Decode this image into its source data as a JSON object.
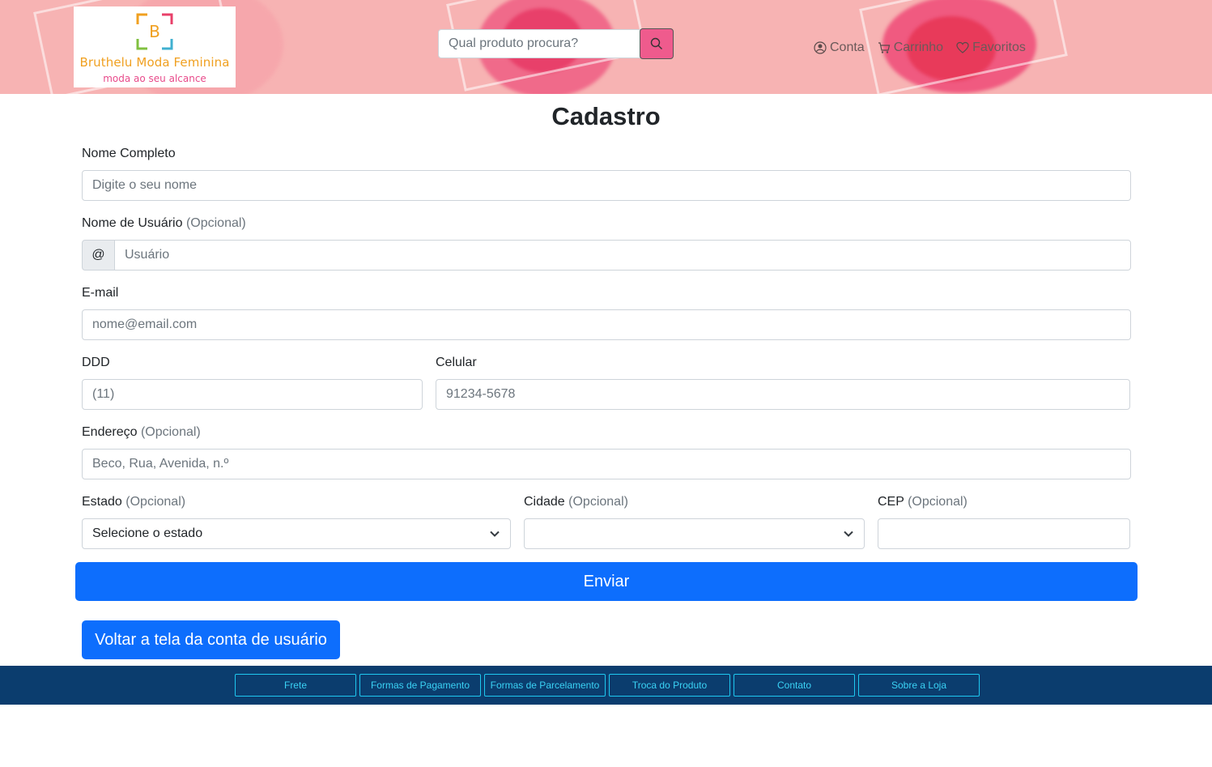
{
  "header": {
    "logo": {
      "letter": "B",
      "title": "Bruthelu Moda Feminina",
      "subtitle": "moda ao seu alcance"
    },
    "search": {
      "placeholder": "Qual produto procura?",
      "icon": "search-icon"
    },
    "nav": [
      {
        "label": "Conta",
        "icon": "user-circle-icon"
      },
      {
        "label": "Carrinho",
        "icon": "cart-icon"
      },
      {
        "label": "Favoritos",
        "icon": "heart-icon"
      }
    ]
  },
  "page": {
    "title": "Cadastro"
  },
  "form": {
    "full_name": {
      "label": "Nome Completo",
      "placeholder": "Digite o seu nome"
    },
    "username": {
      "label": "Nome de Usuário",
      "optional": "(Opcional)",
      "addon": "@",
      "placeholder": "Usuário"
    },
    "email": {
      "label": "E-mail",
      "placeholder": "nome@email.com"
    },
    "ddd": {
      "label": "DDD",
      "placeholder": "(11)"
    },
    "phone": {
      "label": "Celular",
      "placeholder": "91234-5678"
    },
    "address": {
      "label": "Endereço",
      "optional": "(Opcional)",
      "placeholder": "Beco, Rua, Avenida, n.º"
    },
    "state": {
      "label": "Estado",
      "optional": "(Opcional)",
      "selected": "Selecione o estado"
    },
    "city": {
      "label": "Cidade",
      "optional": "(Opcional)",
      "selected": ""
    },
    "cep": {
      "label": "CEP",
      "optional": "(Opcional)",
      "value": ""
    },
    "submit_label": "Enviar",
    "back_label": "Voltar a tela da conta de usuário"
  },
  "footer": {
    "links": [
      "Frete",
      "Formas de Pagamento",
      "Formas de Parcelamento",
      "Troca do Produto",
      "Contato",
      "Sobre a Loja"
    ]
  },
  "colors": {
    "header_bg": "#f7b3b3",
    "primary": "#0d6efd",
    "footer_bg": "#0b3d6e",
    "footer_link": "#3ad2f5",
    "search_button": "#ef5b8d"
  }
}
